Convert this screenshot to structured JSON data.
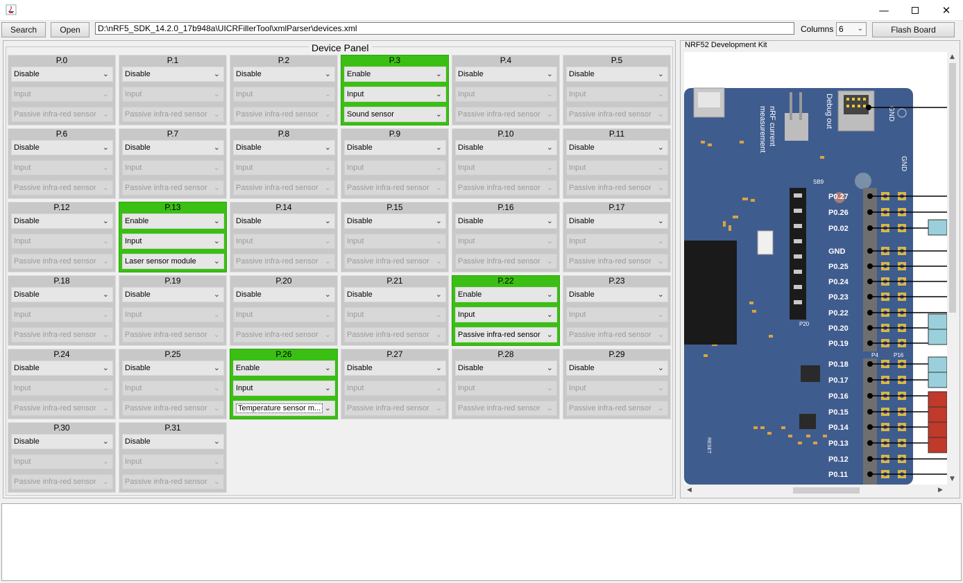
{
  "window": {
    "min_glyph": "—",
    "close_glyph": "✕"
  },
  "toolbar": {
    "search_label": "Search",
    "open_label": "Open",
    "path_value": "D:\\nRF5_SDK_14.2.0_17b948a\\UICRFillerTool\\xmlParser\\devices.xml",
    "columns_label": "Columns",
    "columns_value": "6",
    "flash_label": "Flash Board"
  },
  "device_panel": {
    "title": "Device Panel",
    "pins": [
      {
        "name": "P.0",
        "mode": "Disable",
        "direction": "Input",
        "device": "Passive infra-red sensor",
        "enabled": false
      },
      {
        "name": "P.1",
        "mode": "Disable",
        "direction": "Input",
        "device": "Passive infra-red sensor",
        "enabled": false
      },
      {
        "name": "P.2",
        "mode": "Disable",
        "direction": "Input",
        "device": "Passive infra-red sensor",
        "enabled": false
      },
      {
        "name": "P.3",
        "mode": "Enable",
        "direction": "Input",
        "device": "Sound sensor",
        "enabled": true
      },
      {
        "name": "P.4",
        "mode": "Disable",
        "direction": "Input",
        "device": "Passive infra-red sensor",
        "enabled": false
      },
      {
        "name": "P.5",
        "mode": "Disable",
        "direction": "Input",
        "device": "Passive infra-red sensor",
        "enabled": false
      },
      {
        "name": "P.6",
        "mode": "Disable",
        "direction": "Input",
        "device": "Passive infra-red sensor",
        "enabled": false
      },
      {
        "name": "P.7",
        "mode": "Disable",
        "direction": "Input",
        "device": "Passive infra-red sensor",
        "enabled": false
      },
      {
        "name": "P.8",
        "mode": "Disable",
        "direction": "Input",
        "device": "Passive infra-red sensor",
        "enabled": false
      },
      {
        "name": "P.9",
        "mode": "Disable",
        "direction": "Input",
        "device": "Passive infra-red sensor",
        "enabled": false
      },
      {
        "name": "P.10",
        "mode": "Disable",
        "direction": "Input",
        "device": "Passive infra-red sensor",
        "enabled": false
      },
      {
        "name": "P.11",
        "mode": "Disable",
        "direction": "Input",
        "device": "Passive infra-red sensor",
        "enabled": false
      },
      {
        "name": "P.12",
        "mode": "Disable",
        "direction": "Input",
        "device": "Passive infra-red sensor",
        "enabled": false
      },
      {
        "name": "P.13",
        "mode": "Enable",
        "direction": "Input",
        "device": "Laser sensor module",
        "enabled": true
      },
      {
        "name": "P.14",
        "mode": "Disable",
        "direction": "Input",
        "device": "Passive infra-red sensor",
        "enabled": false
      },
      {
        "name": "P.15",
        "mode": "Disable",
        "direction": "Input",
        "device": "Passive infra-red sensor",
        "enabled": false
      },
      {
        "name": "P.16",
        "mode": "Disable",
        "direction": "Input",
        "device": "Passive infra-red sensor",
        "enabled": false
      },
      {
        "name": "P.17",
        "mode": "Disable",
        "direction": "Input",
        "device": "Passive infra-red sensor",
        "enabled": false
      },
      {
        "name": "P.18",
        "mode": "Disable",
        "direction": "Input",
        "device": "Passive infra-red sensor",
        "enabled": false
      },
      {
        "name": "P.19",
        "mode": "Disable",
        "direction": "Input",
        "device": "Passive infra-red sensor",
        "enabled": false
      },
      {
        "name": "P.20",
        "mode": "Disable",
        "direction": "Input",
        "device": "Passive infra-red sensor",
        "enabled": false
      },
      {
        "name": "P.21",
        "mode": "Disable",
        "direction": "Input",
        "device": "Passive infra-red sensor",
        "enabled": false
      },
      {
        "name": "P.22",
        "mode": "Enable",
        "direction": "Input",
        "device": "Passive infra-red sensor",
        "enabled": true
      },
      {
        "name": "P.23",
        "mode": "Disable",
        "direction": "Input",
        "device": "Passive infra-red sensor",
        "enabled": false
      },
      {
        "name": "P.24",
        "mode": "Disable",
        "direction": "Input",
        "device": "Passive infra-red sensor",
        "enabled": false
      },
      {
        "name": "P.25",
        "mode": "Disable",
        "direction": "Input",
        "device": "Passive infra-red sensor",
        "enabled": false
      },
      {
        "name": "P.26",
        "mode": "Enable",
        "direction": "Input",
        "device": "Temperature sensor m...",
        "enabled": true,
        "focused": true
      },
      {
        "name": "P.27",
        "mode": "Disable",
        "direction": "Input",
        "device": "Passive infra-red sensor",
        "enabled": false
      },
      {
        "name": "P.28",
        "mode": "Disable",
        "direction": "Input",
        "device": "Passive infra-red sensor",
        "enabled": false
      },
      {
        "name": "P.29",
        "mode": "Disable",
        "direction": "Input",
        "device": "Passive infra-red sensor",
        "enabled": false
      },
      {
        "name": "P.30",
        "mode": "Disable",
        "direction": "Input",
        "device": "Passive infra-red sensor",
        "enabled": false
      },
      {
        "name": "P.31",
        "mode": "Disable",
        "direction": "Input",
        "device": "Passive infra-red sensor",
        "enabled": false
      }
    ]
  },
  "board_panel": {
    "title": "NRF52 Development Kit",
    "pin_labels": [
      "P0.27",
      "P0.26",
      "P0.02",
      "GND",
      "P0.25",
      "P0.24",
      "P0.23",
      "P0.22",
      "P0.20",
      "P0.19",
      "P0.18",
      "P0.17",
      "P0.16",
      "P0.15",
      "P0.14",
      "P0.13",
      "P0.12",
      "P0.11"
    ],
    "silk_labels": {
      "nrf_current": "nRF current",
      "measurement": "measurement",
      "debug_out": "Debug out",
      "gnd": "GND",
      "gnd_side": "GND",
      "p20": "P20",
      "p4": "P4",
      "p16": "P16",
      "sb9": "SB9",
      "reset": "RESET"
    },
    "colors": {
      "board": "#3f5c8e",
      "tag_blue": "#9ad0dc",
      "tag_red": "#c0392b"
    }
  },
  "log": {
    "text": ""
  }
}
